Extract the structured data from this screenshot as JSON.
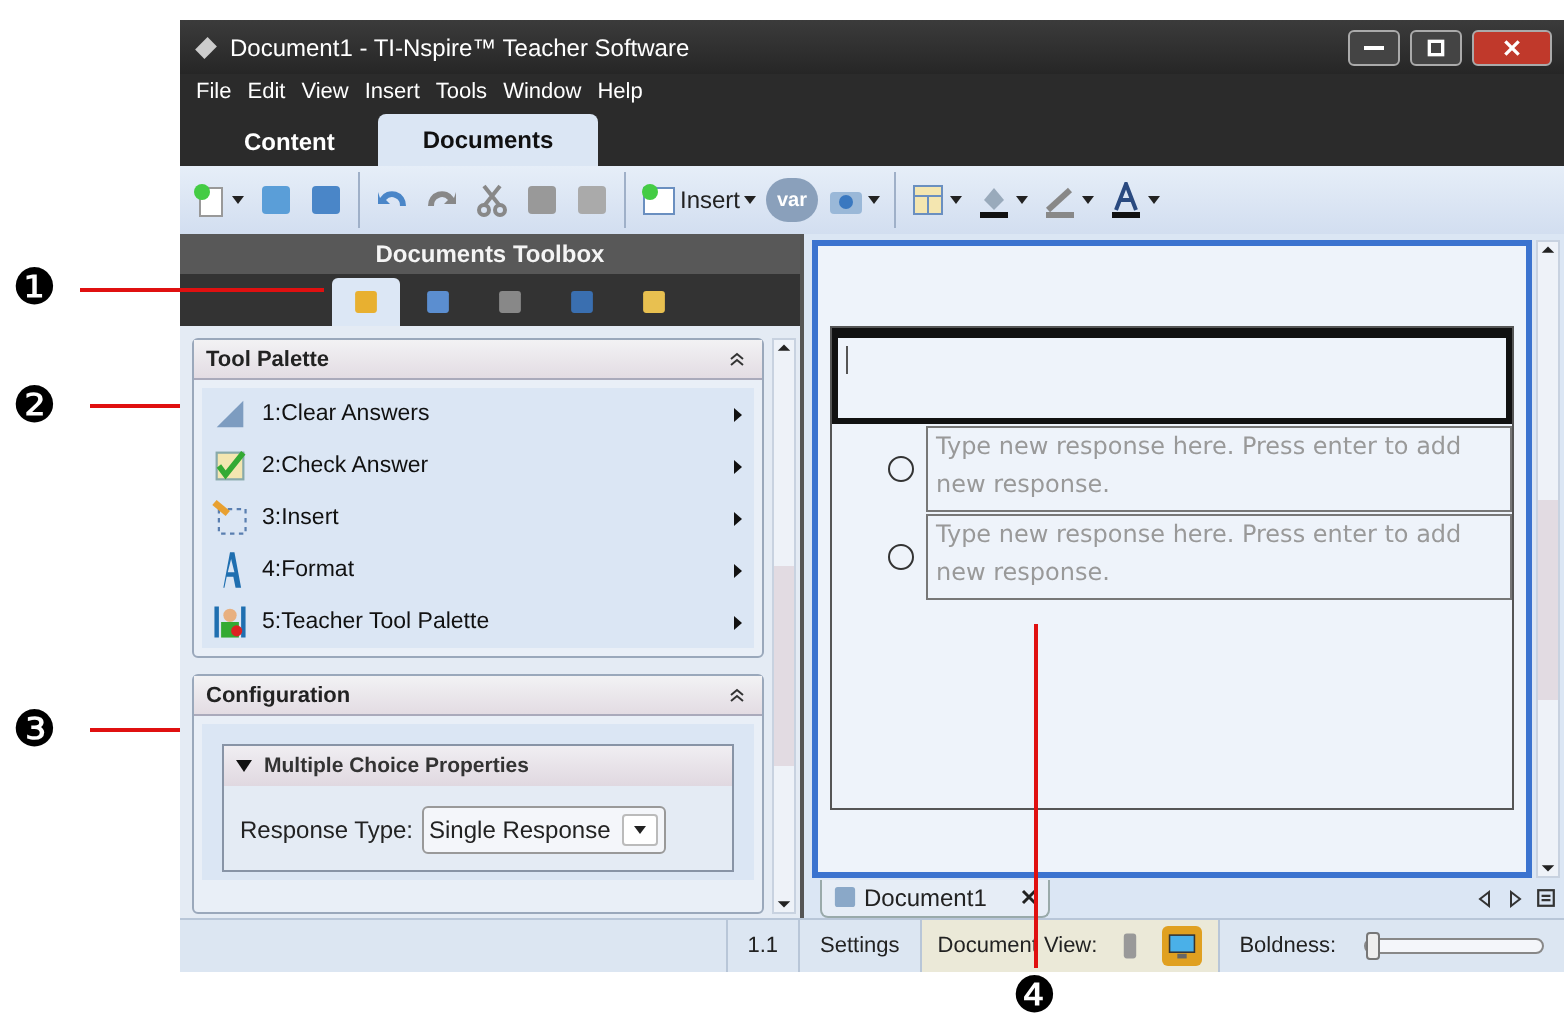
{
  "callouts": [
    {
      "label": "❶"
    },
    {
      "label": "❷"
    },
    {
      "label": "❸"
    },
    {
      "label": "❹"
    }
  ],
  "window": {
    "title": "Document1 - TI-Nspire™ Teacher Software"
  },
  "menu": [
    "File",
    "Edit",
    "View",
    "Insert",
    "Tools",
    "Window",
    "Help"
  ],
  "tabs": [
    {
      "label": "Content",
      "selected": false
    },
    {
      "label": "Documents",
      "selected": true
    }
  ],
  "toolbar": {
    "insert_label": "Insert",
    "var_label": "var"
  },
  "toolbox": {
    "title": "Documents Toolbox",
    "icon_tabs": [
      {
        "selected": true
      },
      {
        "selected": false
      },
      {
        "selected": false
      },
      {
        "selected": false
      },
      {
        "selected": false
      }
    ]
  },
  "tool_palette": {
    "title": "Tool Palette",
    "items": [
      "1:Clear Answers",
      "2:Check Answer",
      "3:Insert",
      "4:Format",
      "5:Teacher Tool Palette"
    ]
  },
  "configuration": {
    "title": "Configuration",
    "group": {
      "title": "Multiple Choice Properties",
      "expanded": true,
      "field_label": "Response Type:",
      "value": "Single Response"
    }
  },
  "document": {
    "responses": [
      {
        "placeholder": "Type new response here. Press enter to add new response.",
        "selected": false
      },
      {
        "placeholder": "Type new response here. Press enter to add new response.",
        "selected": false
      }
    ],
    "tab": "Document1"
  },
  "status_bar": {
    "page": "1.1",
    "settings": "Settings",
    "view_label": "Document View:",
    "views": [
      {
        "selected": false
      },
      {
        "selected": true
      }
    ],
    "boldness_label": "Boldness:",
    "boldness": {
      "level": 0
    }
  }
}
